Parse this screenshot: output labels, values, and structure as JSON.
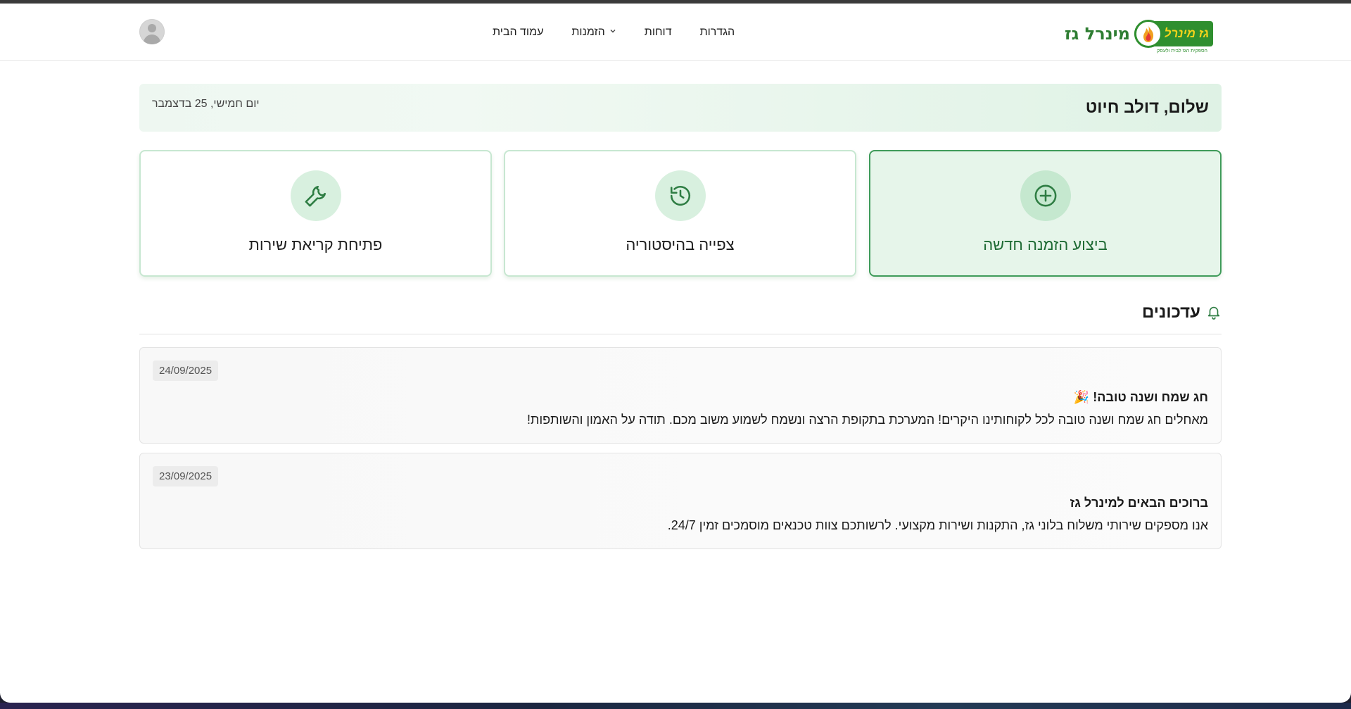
{
  "header": {
    "logo_text": "מינרל גז",
    "logo_badge": "גז מינרל",
    "logo_tagline": "הספקית הגז לבית ולעסק",
    "nav": [
      {
        "label": "הגדרות",
        "icon": ""
      },
      {
        "label": "דוחות",
        "icon": ""
      },
      {
        "label": "הזמנות",
        "icon": "chevron-down-icon"
      },
      {
        "label": "עמוד הבית",
        "icon": ""
      }
    ],
    "avatar_icon": "user-avatar-icon"
  },
  "greeting": {
    "title": "שלום, דולב חיוט",
    "date": "יום חמישי, 25 בדצמבר"
  },
  "actions": [
    {
      "label": "ביצוע הזמנה חדשה",
      "icon": "plus-circle-icon",
      "primary": true
    },
    {
      "label": "צפייה בהיסטוריה",
      "icon": "history-icon",
      "primary": false
    },
    {
      "label": "פתיחת קריאת שירות",
      "icon": "wrench-icon",
      "primary": false
    }
  ],
  "updates": {
    "title": "עדכונים",
    "icon": "bell-icon",
    "items": [
      {
        "date": "24/09/2025",
        "title": "חג שמח ושנה טובה! 🎉",
        "text": "מאחלים חג שמח ושנה טובה לכל לקוחותינו היקרים! המערכת בתקופת הרצה ונשמח לשמוע משוב מכם. תודה על האמון והשותפות!"
      },
      {
        "date": "23/09/2025",
        "title": "ברוכים הבאים למינרל גז",
        "text": "אנו מספקים שירותי משלוח בלוני גז, התקנות ושירות מקצועי. לרשותכם צוות טכנאים מוסמכים זמין 24/7."
      }
    ]
  },
  "colors": {
    "brand_green": "#2f8f2f",
    "accent_green": "#3f9b5a",
    "brand_yellow": "#f5d31b"
  }
}
